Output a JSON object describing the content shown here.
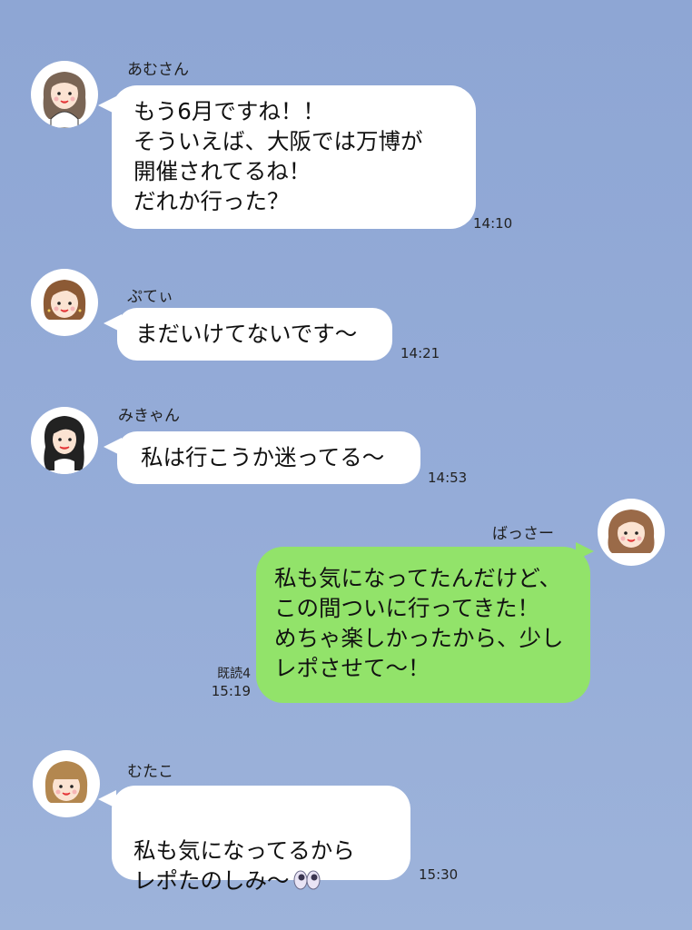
{
  "messages": [
    {
      "sender": "あむさん",
      "text": "もう6月ですね！！\nそういえば、大阪では万博が\n開催されてるね！\nだれか行った？",
      "time": "14:10",
      "avatar": "avatar-amusan"
    },
    {
      "sender": "ぷてぃ",
      "text": "まだいけてないです～",
      "time": "14:21",
      "avatar": "avatar-puti"
    },
    {
      "sender": "みきゃん",
      "text": "私は行こうか迷ってる～",
      "time": "14:53",
      "avatar": "avatar-mikyan"
    },
    {
      "sender": "ばっさー",
      "text": "私も気になってたんだけど、\nこの間ついに行ってきた！\nめちゃ楽しかったから、少し\nレポさせて～！",
      "read": "既読4",
      "time": "15:19",
      "avatar": "avatar-bassa"
    },
    {
      "sender": "むたこ",
      "text": "私も気になってるから\nレポたのしみ～",
      "emoji": "eyes-emoji",
      "time": "15:30",
      "avatar": "avatar-mutako"
    }
  ],
  "colors": {
    "background": "#93aad6",
    "incoming_bubble": "#ffffff",
    "outgoing_bubble": "#92e36a"
  }
}
